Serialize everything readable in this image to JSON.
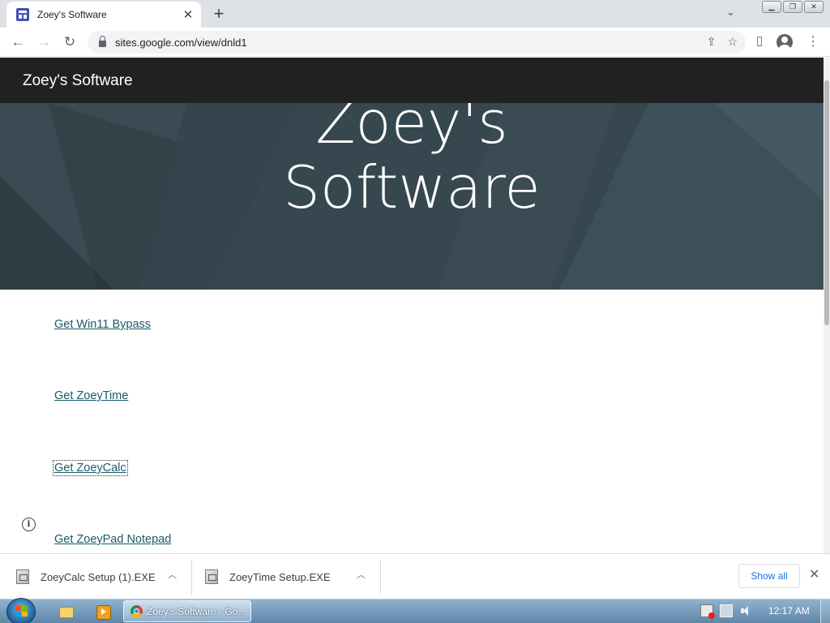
{
  "browser": {
    "tab": {
      "title": "Zoey's Software"
    },
    "url": "sites.google.com/view/dnld1"
  },
  "site": {
    "header_title": "Zoey's Software",
    "hero_title_line1": "Zoey's",
    "hero_title_line2": "Software",
    "links": [
      {
        "label": "Get Win11 Bypass"
      },
      {
        "label": "Get ZoeyTime"
      },
      {
        "label": "Get ZoeyCalc"
      },
      {
        "label": "Get ZoeyPad Notepad"
      }
    ]
  },
  "downloads": {
    "items": [
      {
        "name": "ZoeyCalc Setup (1).EXE"
      },
      {
        "name": "ZoeyTime Setup.EXE"
      }
    ],
    "show_all": "Show all"
  },
  "taskbar": {
    "chrome_window_label": "Zoey's Software - Go...",
    "clock": "12:17 AM"
  },
  "colors": {
    "site_header_bg": "#212121",
    "hero_bg": "#37474f",
    "link_color": "#1b5b68",
    "show_all_color": "#1a73e8"
  }
}
